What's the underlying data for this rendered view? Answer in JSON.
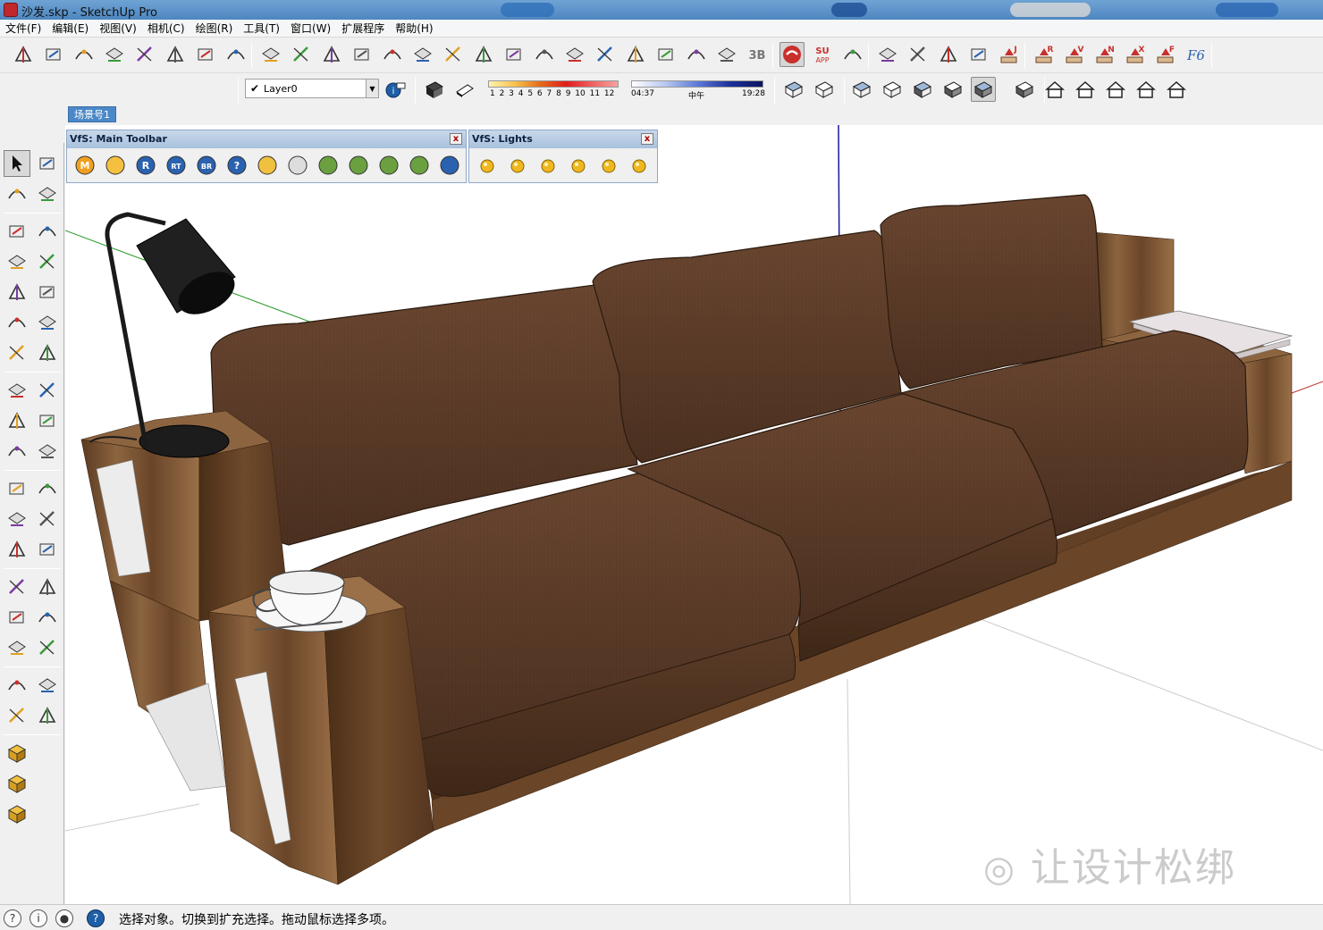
{
  "window": {
    "title": "沙发.skp - SketchUp Pro"
  },
  "menu": [
    "文件(F)",
    "编辑(E)",
    "视图(V)",
    "相机(C)",
    "绘图(R)",
    "工具(T)",
    "窗口(W)",
    "扩展程序",
    "帮助(H)"
  ],
  "layer": {
    "current": "Layer0"
  },
  "shadow": {
    "month_ticks": "1 2 3 4 5 6 7 8 9 10 11 12",
    "time_start": "04:37",
    "time_mid": "中午",
    "time_end": "19:28"
  },
  "scene_tab": "场景号1",
  "vfs_main": {
    "title": "VfS: Main Toolbar",
    "close": "x",
    "buttons": [
      "M",
      "",
      "R",
      "RT",
      "BR",
      "?",
      "",
      "",
      "",
      "",
      "",
      "",
      ""
    ]
  },
  "vfs_lights": {
    "title": "VfS: Lights",
    "close": "x"
  },
  "status": {
    "message": "选择对象。切换到扩充选择。拖动鼠标选择多项。"
  },
  "watermark": "让设计松绑",
  "colors": {
    "titlebar": "#5b93c9",
    "sofa_fabric": "#5a3b27",
    "wood": "#7a5232",
    "blue_axis": "#1a1a9a",
    "green_axis": "#2a9a2a",
    "red_axis": "#c03030"
  },
  "icons": {
    "row1": [
      "select-push-icon",
      "follow-me-icon",
      "offset-icon",
      "move-icon",
      "rotate-icon",
      "scale-icon",
      "tape-icon",
      "draw-line-icon",
      "arc-icon",
      "check-icon",
      "intersect-icon",
      "eraser-icon",
      "component-icon",
      "joint-push-icon",
      "spline-icon",
      "bezier-icon",
      "paint-icon",
      "face-icon",
      "window-icon",
      "cube-icon",
      "stairs-icon",
      "cut-icon",
      "axes-icon",
      "magic-wand-icon",
      "3b-icon",
      "su-logo-icon",
      "su-app-icon",
      "plugin-a-icon",
      "plugin-b-icon",
      "plugin-c-icon",
      "plugin-d-icon",
      "plugin-e-icon",
      "arrow-j-icon",
      "arrow-r-icon",
      "arrow-v-icon",
      "arrow-n-icon",
      "arrow-x-icon",
      "arrow-f-icon",
      "f6-icon"
    ]
  }
}
